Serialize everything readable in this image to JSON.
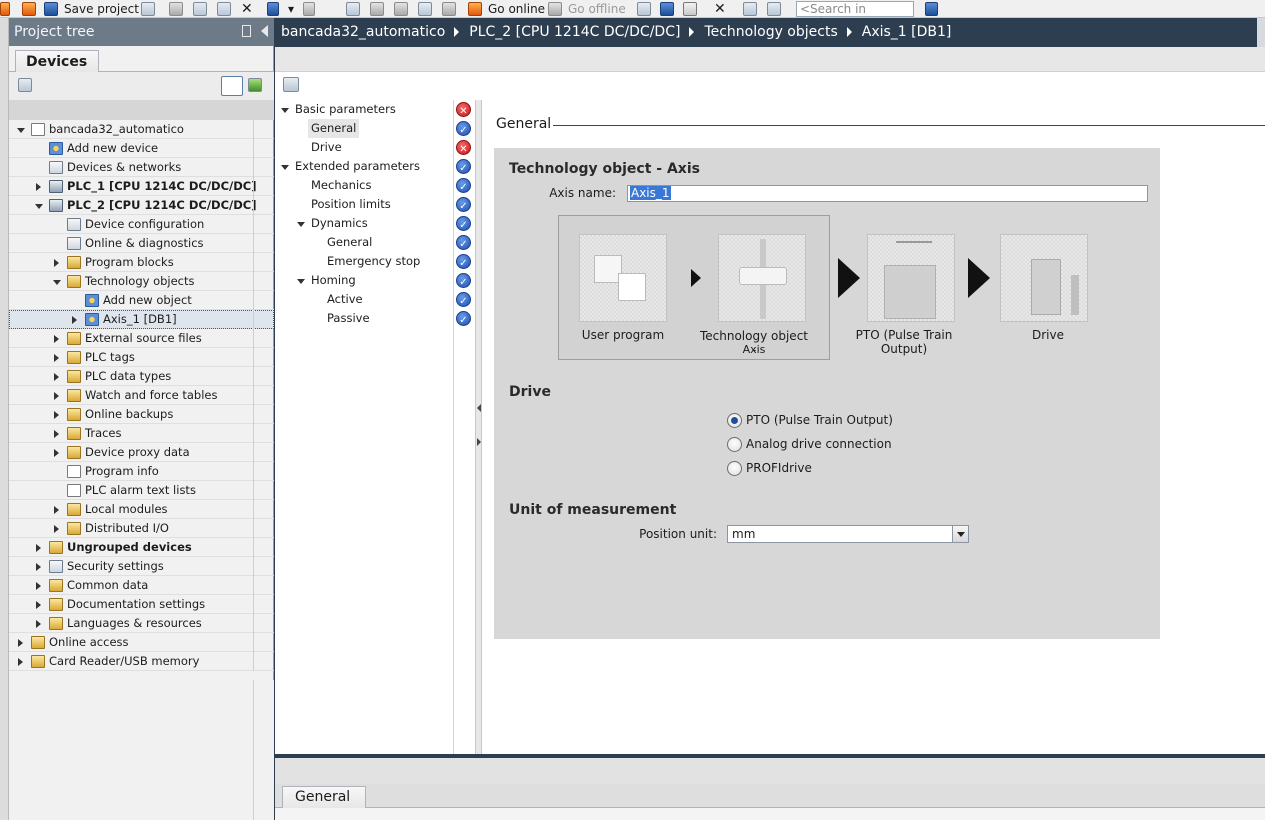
{
  "toolbar": {
    "save_label": "Save project",
    "go_online_label": "Go online",
    "go_offline_label": "Go offline",
    "search_placeholder": "<Search in project>"
  },
  "project_tree": {
    "title": "Project tree",
    "tab_label": "Devices",
    "items": [
      {
        "label": "bancada32_automatico",
        "level": 0,
        "toggle": "down",
        "icon": "project-icon"
      },
      {
        "label": "Add new device",
        "level": 1,
        "toggle": "none",
        "icon": "add-device-icon"
      },
      {
        "label": "Devices & networks",
        "level": 1,
        "toggle": "none",
        "icon": "network-icon"
      },
      {
        "label": "PLC_1 [CPU 1214C DC/DC/DC]",
        "level": 1,
        "toggle": "right",
        "icon": "plc-icon",
        "bold": true
      },
      {
        "label": "PLC_2 [CPU 1214C DC/DC/DC]",
        "level": 1,
        "toggle": "down",
        "icon": "plc-icon",
        "bold": true
      },
      {
        "label": "Device configuration",
        "level": 2,
        "toggle": "none",
        "icon": "device-config-icon"
      },
      {
        "label": "Online & diagnostics",
        "level": 2,
        "toggle": "none",
        "icon": "diagnostics-icon"
      },
      {
        "label": "Program blocks",
        "level": 2,
        "toggle": "right",
        "icon": "folder-icon"
      },
      {
        "label": "Technology objects",
        "level": 2,
        "toggle": "down",
        "icon": "folder-icon"
      },
      {
        "label": "Add new object",
        "level": 3,
        "toggle": "none",
        "icon": "add-object-icon"
      },
      {
        "label": "Axis_1 [DB1]",
        "level": 3,
        "toggle": "right",
        "icon": "axis-icon",
        "selected": true
      },
      {
        "label": "External source files",
        "level": 2,
        "toggle": "right",
        "icon": "folder-icon"
      },
      {
        "label": "PLC tags",
        "level": 2,
        "toggle": "right",
        "icon": "folder-icon"
      },
      {
        "label": "PLC data types",
        "level": 2,
        "toggle": "right",
        "icon": "folder-icon"
      },
      {
        "label": "Watch and force tables",
        "level": 2,
        "toggle": "right",
        "icon": "folder-icon"
      },
      {
        "label": "Online backups",
        "level": 2,
        "toggle": "right",
        "icon": "folder-icon"
      },
      {
        "label": "Traces",
        "level": 2,
        "toggle": "right",
        "icon": "folder-icon"
      },
      {
        "label": "Device proxy data",
        "level": 2,
        "toggle": "right",
        "icon": "folder-icon"
      },
      {
        "label": "Program info",
        "level": 2,
        "toggle": "none",
        "icon": "program-info-icon"
      },
      {
        "label": "PLC alarm text lists",
        "level": 2,
        "toggle": "none",
        "icon": "alarm-list-icon"
      },
      {
        "label": "Local modules",
        "level": 2,
        "toggle": "right",
        "icon": "folder-icon"
      },
      {
        "label": "Distributed I/O",
        "level": 2,
        "toggle": "right",
        "icon": "folder-icon"
      },
      {
        "label": "Ungrouped devices",
        "level": 1,
        "toggle": "right",
        "icon": "folder-icon",
        "bold": true
      },
      {
        "label": "Security settings",
        "level": 1,
        "toggle": "right",
        "icon": "security-icon"
      },
      {
        "label": "Common data",
        "level": 1,
        "toggle": "right",
        "icon": "folder-icon"
      },
      {
        "label": "Documentation settings",
        "level": 1,
        "toggle": "right",
        "icon": "folder-icon"
      },
      {
        "label": "Languages & resources",
        "level": 1,
        "toggle": "right",
        "icon": "folder-icon"
      },
      {
        "label": "Online access",
        "level": 0,
        "toggle": "right",
        "icon": "folder-icon"
      },
      {
        "label": "Card Reader/USB memory",
        "level": 0,
        "toggle": "right",
        "icon": "folder-icon"
      }
    ]
  },
  "breadcrumb": [
    "bancada32_automatico",
    "PLC_2 [CPU 1214C DC/DC/DC]",
    "Technology objects",
    "Axis_1 [DB1]"
  ],
  "nav": [
    {
      "label": "Basic parameters",
      "level": 0,
      "toggle": "down",
      "status": "err"
    },
    {
      "label": "General",
      "level": 1,
      "toggle": "none",
      "status": "ok",
      "selected": true
    },
    {
      "label": "Drive",
      "level": 1,
      "toggle": "none",
      "status": "err"
    },
    {
      "label": "Extended parameters",
      "level": 0,
      "toggle": "down",
      "status": "ok"
    },
    {
      "label": "Mechanics",
      "level": 1,
      "toggle": "none",
      "status": "ok"
    },
    {
      "label": "Position limits",
      "level": 1,
      "toggle": "none",
      "status": "ok"
    },
    {
      "label": "Dynamics",
      "level": 1,
      "toggle": "down",
      "status": "ok"
    },
    {
      "label": "General",
      "level": 2,
      "toggle": "none",
      "status": "ok"
    },
    {
      "label": "Emergency stop",
      "level": 2,
      "toggle": "none",
      "status": "ok"
    },
    {
      "label": "Homing",
      "level": 1,
      "toggle": "down",
      "status": "ok"
    },
    {
      "label": "Active",
      "level": 2,
      "toggle": "none",
      "status": "ok"
    },
    {
      "label": "Passive",
      "level": 2,
      "toggle": "none",
      "status": "ok"
    }
  ],
  "content": {
    "section_title": "General",
    "tech_object_heading": "Technology object - Axis",
    "axis_name_label": "Axis name:",
    "axis_name_value": "Axis_1",
    "flow": {
      "user_program": "User program",
      "tech_object_line1": "Technology object -",
      "tech_object_line2": "Axis",
      "pto": "PTO (Pulse Train Output)",
      "drive": "Drive"
    },
    "drive_heading": "Drive",
    "drive_options": [
      {
        "label": "PTO (Pulse Train Output)",
        "selected": true
      },
      {
        "label": "Analog drive connection",
        "selected": false
      },
      {
        "label": "PROFIdrive",
        "selected": false
      }
    ],
    "unit_heading": "Unit of measurement",
    "position_unit_label": "Position unit:",
    "position_unit_value": "mm"
  },
  "bottom": {
    "tab_label": "General"
  },
  "colors": {
    "header_dark": "#2c3e50",
    "tree_header": "#6d7a87",
    "status_ok": "#1d4fb1",
    "status_err": "#c51818",
    "panel_bg": "#d7d7d7"
  }
}
